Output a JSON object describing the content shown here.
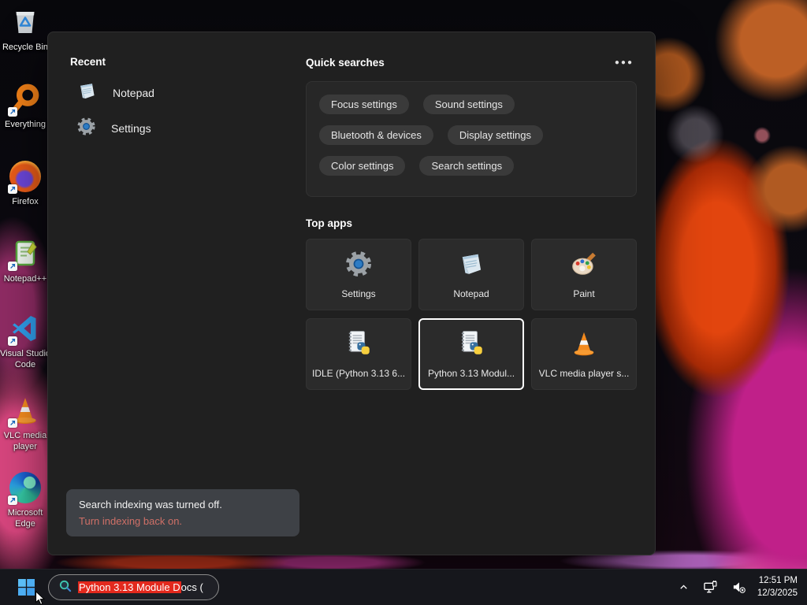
{
  "desktop": {
    "icons": [
      {
        "label": "Recycle Bin"
      },
      {
        "label": "Everything"
      },
      {
        "label": "Firefox"
      },
      {
        "label": "Notepad++"
      },
      {
        "label": "Visual Studio\nCode"
      },
      {
        "label": "VLC media\nplayer"
      },
      {
        "label": "Microsoft\nEdge"
      }
    ]
  },
  "panel": {
    "recent": {
      "title": "Recent",
      "items": [
        {
          "label": "Notepad"
        },
        {
          "label": "Settings"
        }
      ]
    },
    "quick_searches": {
      "title": "Quick searches",
      "more_label": "●●●",
      "pills": [
        "Focus settings",
        "Sound settings",
        "Bluetooth & devices",
        "Display settings",
        "Color settings",
        "Search settings"
      ]
    },
    "top_apps": {
      "title": "Top apps",
      "tiles": [
        {
          "label": "Settings"
        },
        {
          "label": "Notepad"
        },
        {
          "label": "Paint"
        },
        {
          "label": "IDLE (Python 3.13 6..."
        },
        {
          "label": "Python 3.13 Modul...",
          "selected": true
        },
        {
          "label": "VLC media player s..."
        }
      ]
    },
    "notice": {
      "message": "Search indexing was turned off.",
      "link": "Turn indexing back on."
    }
  },
  "taskbar": {
    "search": {
      "selected_text": "Python 3.13 Module D",
      "rest_text": "ocs ("
    },
    "tray": {
      "time": "12:51 PM",
      "date": "12/3/2025"
    }
  },
  "colors": {
    "selection_highlight": "#e3291d",
    "notice_link": "#cf7067",
    "panel_bg": "#202020",
    "taskbar_bg": "#16171c"
  }
}
